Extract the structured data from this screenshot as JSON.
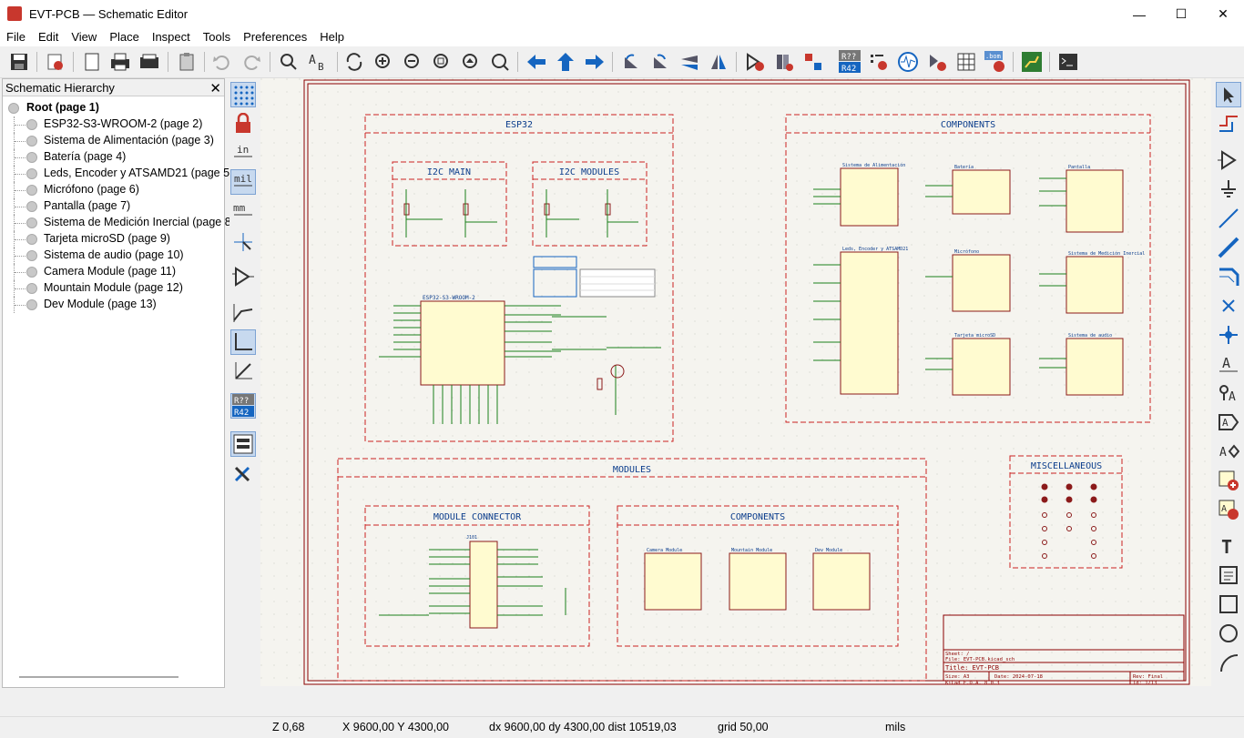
{
  "window": {
    "title": "EVT-PCB — Schematic Editor",
    "min": "—",
    "max": "☐",
    "close": "✕"
  },
  "menu": [
    "File",
    "Edit",
    "View",
    "Place",
    "Inspect",
    "Tools",
    "Preferences",
    "Help"
  ],
  "hierarchy": {
    "title": "Schematic Hierarchy",
    "close": "✕",
    "root": "Root (page 1)",
    "items": [
      "ESP32-S3-WROOM-2 (page 2)",
      "Sistema de Alimentación (page 3)",
      "Batería (page 4)",
      "Leds, Encoder y ATSAMD21 (page 5)",
      "Micrófono (page 6)",
      "Pantalla (page 7)",
      "Sistema de Medición Inercial (page 8)",
      "Tarjeta microSD (page 9)",
      "Sistema de audio (page 10)",
      "Camera Module (page 11)",
      "Mountain Module (page 12)",
      "Dev Module (page 13)"
    ]
  },
  "left_toolbar": {
    "unit_in": "in",
    "unit_mil": "mil",
    "unit_mm": "mm",
    "annot": "R??\nR42"
  },
  "toolbar": {
    "annotate_label": "R??\nR42",
    "bom_label": ".bom"
  },
  "schematic": {
    "esp32": "ESP32",
    "i2c_main": "I2C MAIN",
    "i2c_modules": "I2C MODULES",
    "components_top": "COMPONENTS",
    "modules": "MODULES",
    "module_connector": "MODULE CONNECTOR",
    "components_mod": "COMPONENTS",
    "misc": "MISCELLANEOUS",
    "sheets_top": [
      "Sistema de Alimentación",
      "Batería",
      "Pantalla",
      "Leds, Encoder y ATSAMD21",
      "Micrófono",
      "Sistema de Medición Inercial",
      "Tarjeta microSD",
      "Sistema de audio"
    ],
    "sheets_mod": [
      "Camera Module",
      "Mountain Module",
      "Dev Module"
    ],
    "esp_ref": "ESP32-S3-WROOM-2",
    "connector_ref": "J101",
    "tb_sheet": "Sheet: /",
    "tb_file": "File: EVT-PCB.kicad_sch",
    "tb_title": "Title: EVT-PCB",
    "tb_size": "Size: A3",
    "tb_date": "Date: 2024-07-18",
    "tb_rev": "Rev: Final",
    "tb_tool": "KiCad E.D.A. 8.0.3",
    "tb_id": "Id: 1/13"
  },
  "status": {
    "zoom": "Z 0,68",
    "xy": "X 9600,00  Y 4300,00",
    "delta": "dx 9600,00  dy 4300,00  dist 10519,03",
    "grid": "grid 50,00",
    "units": "mils"
  }
}
